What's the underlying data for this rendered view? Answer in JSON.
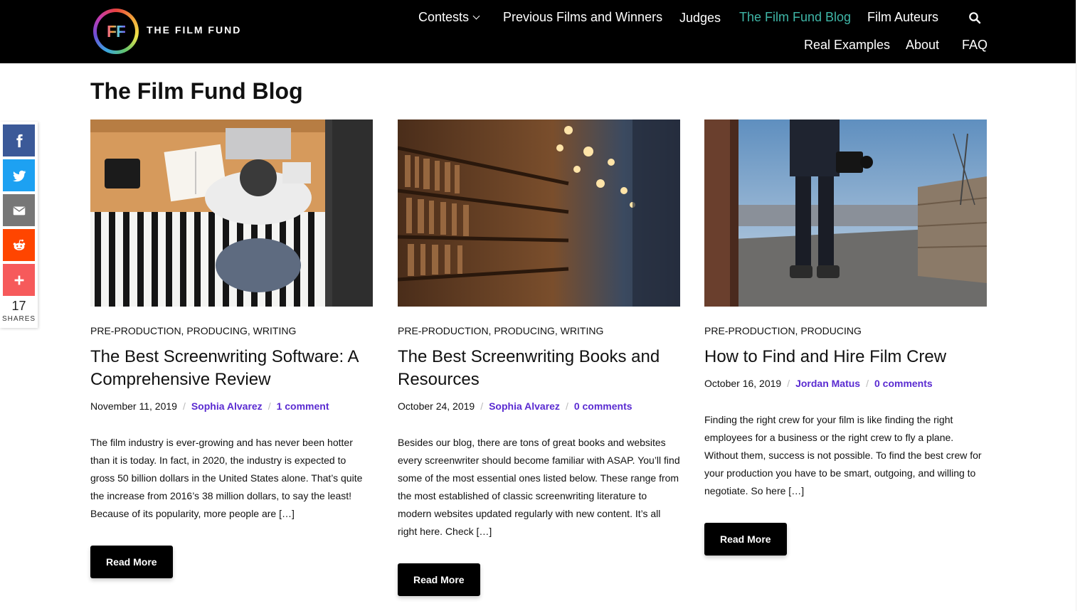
{
  "brand": {
    "logo_letters": "FF",
    "name": "THE FILM FUND"
  },
  "nav": {
    "row1": [
      {
        "label": "Contests",
        "has_dropdown": true
      },
      {
        "label": "Previous Films and Winners"
      },
      {
        "label": "Judges"
      },
      {
        "label": "The Film Fund Blog",
        "active": true
      },
      {
        "label": "Film Auteurs"
      }
    ],
    "row2": [
      {
        "label": "Real Examples"
      },
      {
        "label": "About"
      },
      {
        "label": "FAQ"
      }
    ],
    "search_icon": "search-icon"
  },
  "page": {
    "title": "The Film Fund Blog"
  },
  "social": {
    "buttons": [
      {
        "name": "facebook",
        "color": "#3b5998"
      },
      {
        "name": "twitter",
        "color": "#1da1f2"
      },
      {
        "name": "email",
        "color": "#777777"
      },
      {
        "name": "reddit",
        "color": "#ff4500"
      },
      {
        "name": "more",
        "color": "#f65a5b"
      }
    ],
    "count": "17",
    "label": "SHARES"
  },
  "posts": [
    {
      "categories": "PRE-PRODUCTION, PRODUCING, WRITING",
      "title": "The Best Screenwriting Software: A Comprehensive Review",
      "date": "November 11, 2019",
      "author": "Sophia Alvarez",
      "comments": "1 comment",
      "excerpt": "The film industry is ever-growing and has never been hotter than it is today. In fact, in 2020, the industry is expected to gross 50 billion dollars in the United States alone. That’s quite the increase from 2016’s 38 million dollars, to say the least! Because of its popularity, more people are […]",
      "button": "Read More"
    },
    {
      "categories": "PRE-PRODUCTION, PRODUCING, WRITING",
      "title": "The Best Screenwriting Books and Resources",
      "date": "October 24, 2019",
      "author": "Sophia Alvarez",
      "comments": "0 comments",
      "excerpt": "Besides our blog, there are tons of great books and websites every screenwriter should become familiar with ASAP. You’ll find some of the most essential ones listed below. These range from the most established of classic screenwriting literature to modern websites updated regularly with new content. It’s all right here.  Check […]",
      "button": "Read More"
    },
    {
      "categories": "PRE-PRODUCTION, PRODUCING",
      "title": "How to Find and Hire Film Crew",
      "date": "October 16, 2019",
      "author": "Jordan Matus",
      "comments": "0 comments",
      "excerpt": "Finding the right crew for your film is like finding the right employees for a business or the right crew to fly a plane. Without them, success is not possible. To find the best crew for your production you have to be smart, outgoing, and willing to negotiate. So here […]",
      "button": "Read More"
    }
  ],
  "colors": {
    "accent_nav": "#3fb6a7",
    "link": "#5a2bd1",
    "header_bg": "#000000"
  }
}
